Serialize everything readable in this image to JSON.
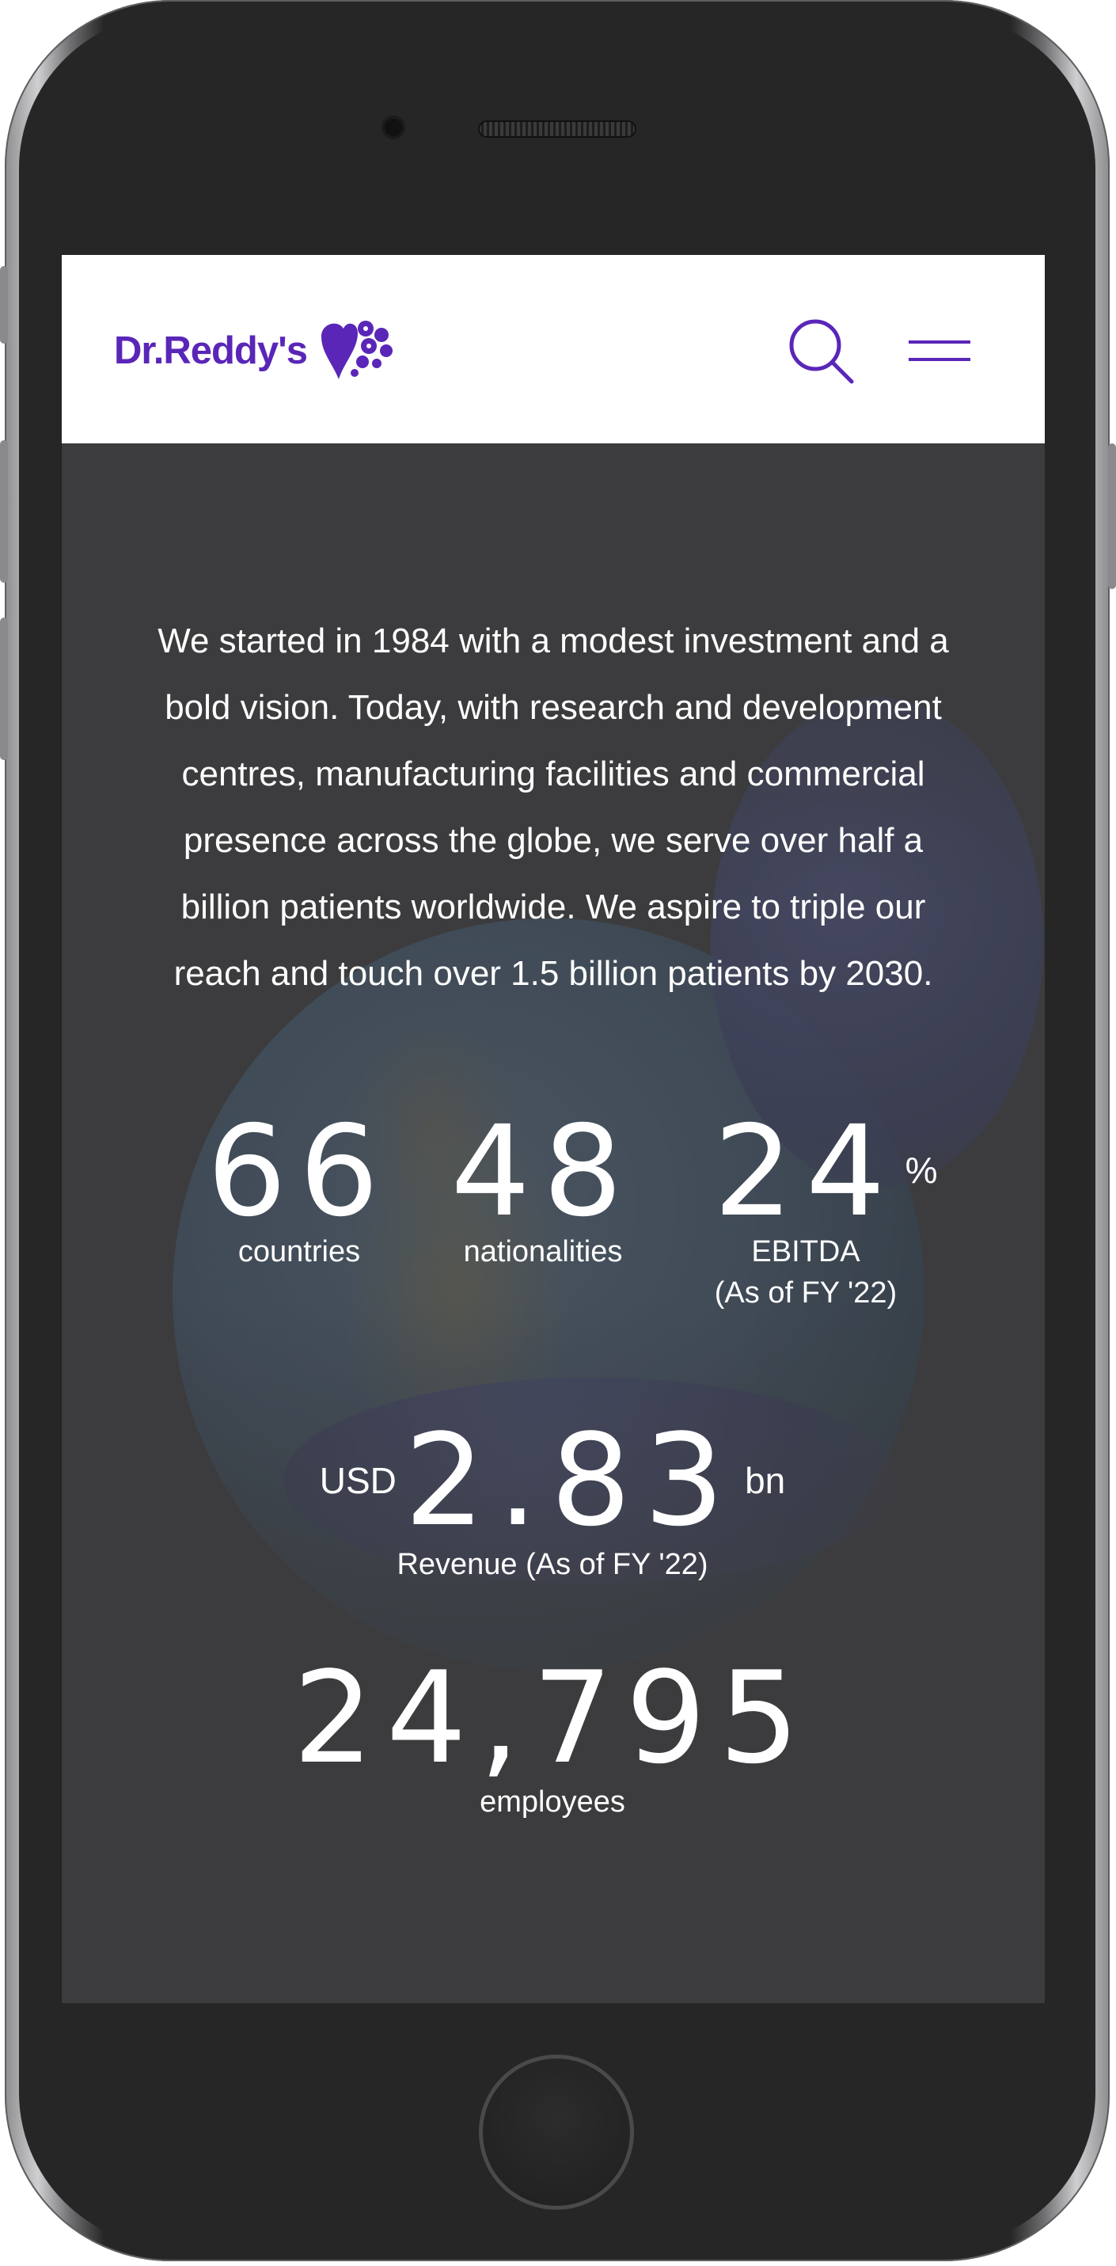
{
  "brand": {
    "name": "Dr.Reddy's",
    "color": "#5a26b8"
  },
  "header": {
    "search_icon": "search-icon",
    "menu_icon": "hamburger-menu-icon"
  },
  "intro": {
    "text": "We started in 1984 with a modest investment and a bold vision. Today, with research and development centres, manufacturing facilities and commercial presence across the globe, we serve over half a billion patients worldwide. We aspire to triple our reach and touch over 1.5 billion patients by 2030."
  },
  "stats": {
    "countries": {
      "value": "66",
      "label": "countries"
    },
    "nationalities": {
      "value": "48",
      "label": "nationalities"
    },
    "ebitda": {
      "value": "24",
      "unit": "%",
      "label": "EBITDA",
      "sublabel": "(As of FY '22)"
    },
    "revenue": {
      "prefix": "USD",
      "value": "2.83",
      "suffix": "bn",
      "label": "Revenue (As of FY '22)"
    },
    "employees": {
      "value": "24,795",
      "label": "employees"
    }
  }
}
